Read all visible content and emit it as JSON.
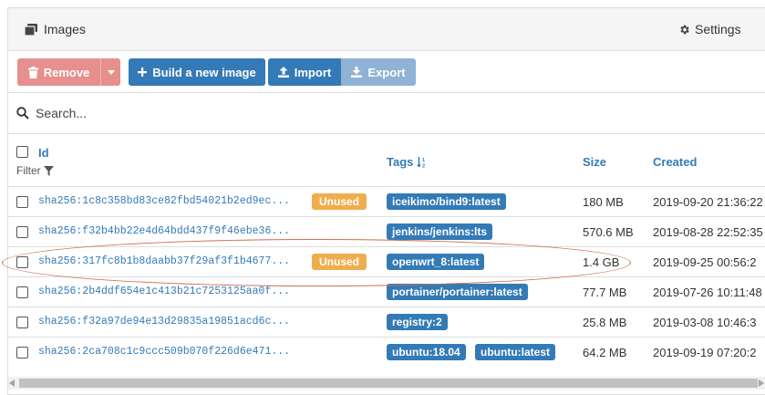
{
  "header": {
    "title": "Images",
    "settings_label": "Settings"
  },
  "toolbar": {
    "remove_label": "Remove",
    "build_label": "Build a new image",
    "import_label": "Import",
    "export_label": "Export"
  },
  "search": {
    "placeholder": "Search..."
  },
  "table": {
    "col_id": "Id",
    "filter_label": "Filter",
    "col_tags": "Tags",
    "col_size": "Size",
    "col_created": "Created",
    "rows": [
      {
        "id": "sha256:1c8c358bd83ce82fbd54021b2ed9ec...",
        "badge": "Unused",
        "tags": [
          "iceikimo/bind9:latest"
        ],
        "size": "180 MB",
        "created": "2019-09-20 21:36:22"
      },
      {
        "id": "sha256:f32b4bb22e4d64bdd437f9f46ebe36...",
        "badge": "",
        "tags": [
          "jenkins/jenkins:lts"
        ],
        "size": "570.6 MB",
        "created": "2019-08-28 22:52:35"
      },
      {
        "id": "sha256:317fc8b1b8daabb37f29af3f1b4677...",
        "badge": "Unused",
        "tags": [
          "openwrt_8:latest"
        ],
        "size": "1.4 GB",
        "created": "2019-09-25 00:56:2"
      },
      {
        "id": "sha256:2b4ddf654e1c413b21c7253125aa0f...",
        "badge": "",
        "tags": [
          "portainer/portainer:latest"
        ],
        "size": "77.7 MB",
        "created": "2019-07-26 10:11:48"
      },
      {
        "id": "sha256:f32a97de94e13d29835a19851acd6c...",
        "badge": "",
        "tags": [
          "registry:2"
        ],
        "size": "25.8 MB",
        "created": "2019-03-08 10:46:3"
      },
      {
        "id": "sha256:2ca708c1c9ccc509b070f226d6e471...",
        "badge": "",
        "tags": [
          "ubuntu:18.04",
          "ubuntu:latest"
        ],
        "size": "64.2 MB",
        "created": "2019-09-19 07:20:2"
      }
    ]
  },
  "colors": {
    "primary": "#337ab7",
    "danger_disabled": "#e5908d",
    "warning": "#f0ad4e",
    "highlight": "#cc6f50"
  }
}
